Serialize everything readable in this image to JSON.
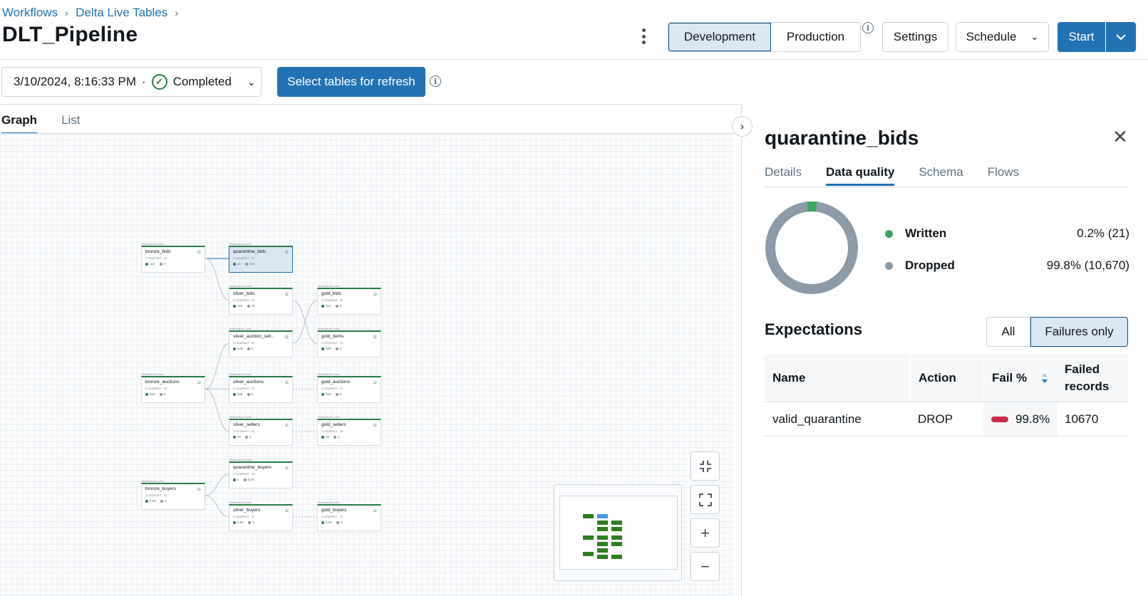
{
  "breadcrumb": [
    "Workflows",
    "Delta Live Tables"
  ],
  "pipeline_title": "DLT_Pipeline",
  "mode_toggle": {
    "development": "Development",
    "production": "Production"
  },
  "header_buttons": {
    "settings": "Settings",
    "schedule": "Schedule",
    "start": "Start"
  },
  "run_selector": {
    "timestamp": "3/10/2024, 8:16:33 PM",
    "separator": "·",
    "status": "Completed"
  },
  "refresh_button": "Select tables for refresh",
  "view_tabs": [
    "Graph",
    "List"
  ],
  "graph": {
    "node_caption": "Materialized view",
    "node_status": "Completed · 3s",
    "nodes": [
      {
        "name": "bronze_bids",
        "m1": "11K",
        "m2": "0"
      },
      {
        "name": "quarantine_bids",
        "m1": "21",
        "m2": "11K"
      },
      {
        "name": "silver_bids",
        "m1": "11K",
        "m2": "1k"
      },
      {
        "name": "gold_bids",
        "m1": "11K",
        "m2": "0"
      },
      {
        "name": "silver_auction_sell...",
        "m1": "628",
        "m2": "0"
      },
      {
        "name": "gold_items",
        "m1": "628",
        "m2": "0"
      },
      {
        "name": "bronze_auctions",
        "m1": "628",
        "m2": "0"
      },
      {
        "name": "silver_auctions",
        "m1": "628",
        "m2": "0"
      },
      {
        "name": "gold_auctions",
        "m1": "628",
        "m2": "0"
      },
      {
        "name": "silver_sellers",
        "m1": "85",
        "m2": "0"
      },
      {
        "name": "gold_sellers",
        "m1": "85",
        "m2": "0"
      },
      {
        "name": "quarantine_buyers",
        "m1": "1",
        "m2": "5.6K"
      },
      {
        "name": "bronze_buyers",
        "m1": "5.6K",
        "m2": "0"
      },
      {
        "name": "silver_buyers",
        "m1": "5.6K",
        "m2": "1"
      },
      {
        "name": "gold_buyers",
        "m1": "5.6K",
        "m2": "0"
      }
    ]
  },
  "panel": {
    "title": "quarantine_bids",
    "tabs": [
      "Details",
      "Data quality",
      "Schema",
      "Flows"
    ],
    "active_tab": "Data quality",
    "donut": {
      "written_fraction": 0.002,
      "written_color": "#3ba65e",
      "dropped_color": "#8c9ba7"
    },
    "legend": [
      {
        "label": "Written",
        "value": "0.2% (21)",
        "color": "#3ba65e"
      },
      {
        "label": "Dropped",
        "value": "99.8% (10,670)",
        "color": "#8c9ba7"
      }
    ],
    "expectations_title": "Expectations",
    "filter": {
      "all": "All",
      "failures_only": "Failures only"
    },
    "columns": {
      "name": "Name",
      "action": "Action",
      "fail_pct": "Fail %",
      "failed_records": "Failed records"
    },
    "rows": [
      {
        "name": "valid_quarantine",
        "action": "DROP",
        "fail_pct": "99.8%",
        "failed_records": "10670"
      }
    ]
  },
  "colors": {
    "accent": "#2272b4",
    "success": "#277c43",
    "error": "#c82d4c"
  }
}
